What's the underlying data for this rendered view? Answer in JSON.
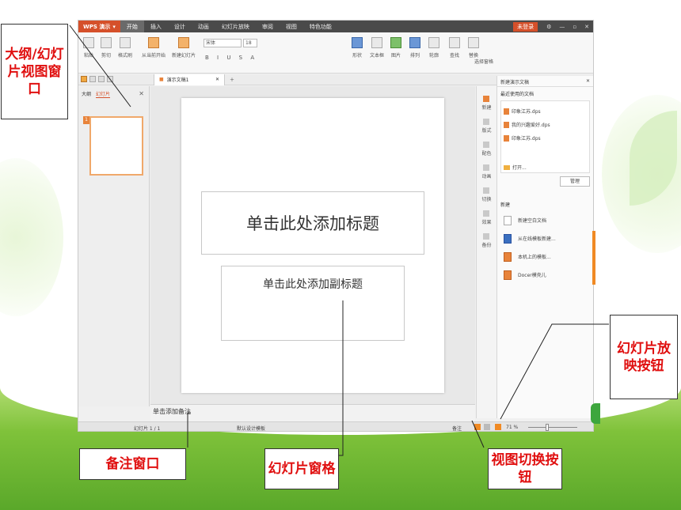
{
  "titlebar": {
    "app_button": "WPS 演示",
    "tabs": [
      "开始",
      "插入",
      "设计",
      "动画",
      "幻灯片放映",
      "审阅",
      "视图",
      "特色功能"
    ],
    "login": "未登录"
  },
  "ribbon": {
    "paste": "粘贴",
    "cut": "剪切",
    "copy": "复制",
    "format_painter": "格式刷",
    "from_current": "从当前开始",
    "new_slide": "新建幻灯片",
    "font_name": "宋体",
    "font_size": "18",
    "shape": "形状",
    "textbox": "文本框",
    "picture": "图片",
    "arrange": "排列",
    "outline": "轮廓",
    "find": "查找",
    "replace": "替换",
    "select_pane": "选择窗格"
  },
  "doc_tab": {
    "name": "演示文稿1"
  },
  "outline_pane": {
    "tab_outline": "大纲",
    "tab_slides": "幻灯片",
    "slide_number": "1"
  },
  "slide": {
    "title_placeholder": "单击此处添加标题",
    "subtitle_placeholder": "单击此处添加副标题"
  },
  "notes": {
    "placeholder": "单击添加备注"
  },
  "side_icons": [
    "新建",
    "版式",
    "配色",
    "动画",
    "切换",
    "效果",
    "备份"
  ],
  "task_pane": {
    "header": "新建演示文稿",
    "recent_label": "最近使用的文档",
    "recent_files": [
      "印象江苏.dps",
      "我的兴趣爱好.dps",
      "印象江苏.dps"
    ],
    "open": "打开...",
    "manage": "管理",
    "new_label": "新建",
    "new_items": [
      "新建空白文档",
      "从在线模板新建...",
      "本机上的模板...",
      "Docer模壳儿"
    ]
  },
  "statusbar": {
    "slide_count": "幻灯片 1 / 1",
    "template": "默认设计模板",
    "notes_btn": "备注",
    "zoom": "71 %"
  },
  "callouts": {
    "outline_view": "大纲/幻灯片视图窗口",
    "slideshow_btn": "幻灯片放映按钮",
    "notes_window": "备注窗口",
    "slide_pane": "幻灯片窗格",
    "view_switch": "视图切换按钮"
  },
  "colors": {
    "accent": "#d5502a",
    "callout_text": "#e01010",
    "grass": "#7fc23a"
  }
}
